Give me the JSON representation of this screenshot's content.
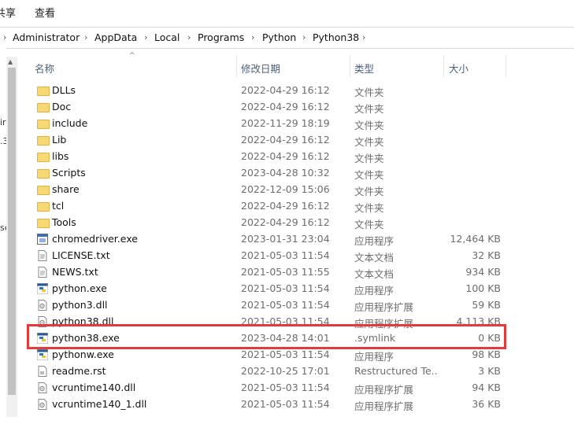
{
  "ribbon": {
    "tabs": [
      "共享",
      "查看"
    ]
  },
  "breadcrumb": [
    "Administrator",
    "AppData",
    "Local",
    "Programs",
    "Python",
    "Python38"
  ],
  "columns": {
    "name": "名称",
    "date": "修改日期",
    "type": "类型",
    "size": "大小"
  },
  "left_fragments": [
    "ir",
    ".3",
    "se"
  ],
  "files": [
    {
      "name": "DLLs",
      "date": "2022-04-29 16:12",
      "type": "文件夹",
      "size": "",
      "icon": "folder-icon"
    },
    {
      "name": "Doc",
      "date": "2022-04-29 16:12",
      "type": "文件夹",
      "size": "",
      "icon": "folder-icon"
    },
    {
      "name": "include",
      "date": "2022-11-29 18:19",
      "type": "文件夹",
      "size": "",
      "icon": "folder-icon"
    },
    {
      "name": "Lib",
      "date": "2022-04-29 16:12",
      "type": "文件夹",
      "size": "",
      "icon": "folder-icon"
    },
    {
      "name": "libs",
      "date": "2022-04-29 16:12",
      "type": "文件夹",
      "size": "",
      "icon": "folder-icon"
    },
    {
      "name": "Scripts",
      "date": "2023-04-28 10:32",
      "type": "文件夹",
      "size": "",
      "icon": "folder-icon"
    },
    {
      "name": "share",
      "date": "2022-12-09 15:06",
      "type": "文件夹",
      "size": "",
      "icon": "folder-icon"
    },
    {
      "name": "tcl",
      "date": "2022-04-29 16:12",
      "type": "文件夹",
      "size": "",
      "icon": "folder-icon"
    },
    {
      "name": "Tools",
      "date": "2022-04-29 16:12",
      "type": "文件夹",
      "size": "",
      "icon": "folder-icon"
    },
    {
      "name": "chromedriver.exe",
      "date": "2023-01-31 23:04",
      "type": "应用程序",
      "size": "12,464 KB",
      "icon": "exe-icon"
    },
    {
      "name": "LICENSE.txt",
      "date": "2021-05-03 11:54",
      "type": "文本文档",
      "size": "32 KB",
      "icon": "text-file-icon"
    },
    {
      "name": "NEWS.txt",
      "date": "2021-05-03 11:55",
      "type": "文本文档",
      "size": "934 KB",
      "icon": "text-file-icon"
    },
    {
      "name": "python.exe",
      "date": "2021-05-03 11:54",
      "type": "应用程序",
      "size": "100 KB",
      "icon": "python-icon"
    },
    {
      "name": "python3.dll",
      "date": "2021-05-03 11:54",
      "type": "应用程序扩展",
      "size": "59 KB",
      "icon": "dll-icon"
    },
    {
      "name": "python38.dll",
      "date": "2021-05-03 11:54",
      "type": "应用程序扩展",
      "size": "4,113 KB",
      "icon": "dll-icon"
    },
    {
      "name": "python38.exe",
      "date": "2023-04-28 14:01",
      "type": ".symlink",
      "size": "0 KB",
      "icon": "python-icon"
    },
    {
      "name": "pythonw.exe",
      "date": "2021-05-03 11:54",
      "type": "应用程序",
      "size": "98 KB",
      "icon": "python-icon"
    },
    {
      "name": "readme.rst",
      "date": "2022-10-25 17:01",
      "type": "Restructured Te...",
      "size": "3 KB",
      "icon": "rst-file-icon"
    },
    {
      "name": "vcruntime140.dll",
      "date": "2021-05-03 11:54",
      "type": "应用程序扩展",
      "size": "94 KB",
      "icon": "dll-icon"
    },
    {
      "name": "vcruntime140_1.dll",
      "date": "2021-05-03 11:54",
      "type": "应用程序扩展",
      "size": "36 KB",
      "icon": "dll-icon"
    }
  ],
  "colors": {
    "highlight": "#e23b3b",
    "folder": "#f8d775",
    "header_text": "#4c607a"
  }
}
